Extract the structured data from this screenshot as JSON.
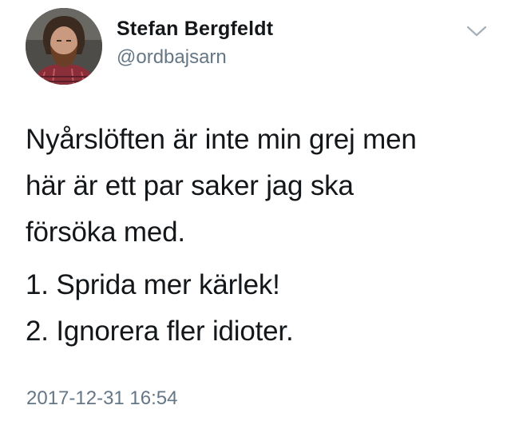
{
  "tweet": {
    "author": {
      "display_name": "Stefan Bergfeldt",
      "handle": "@ordbajsarn",
      "avatar_icon": "profile-photo"
    },
    "menu_icon": "chevron-down-icon",
    "text": {
      "paragraph1": [
        "Nyårslöften är inte min grej men",
        "här är ett par saker jag ska",
        "försöka med."
      ],
      "paragraph2": [
        "1. Sprida mer kärlek!",
        "2. Ignorera fler idioter."
      ]
    },
    "timestamp": "2017-12-31 16:54"
  },
  "colors": {
    "text": "#14171a",
    "secondary_text": "#657786",
    "chevron": "#a4afb8",
    "background": "#ffffff"
  }
}
